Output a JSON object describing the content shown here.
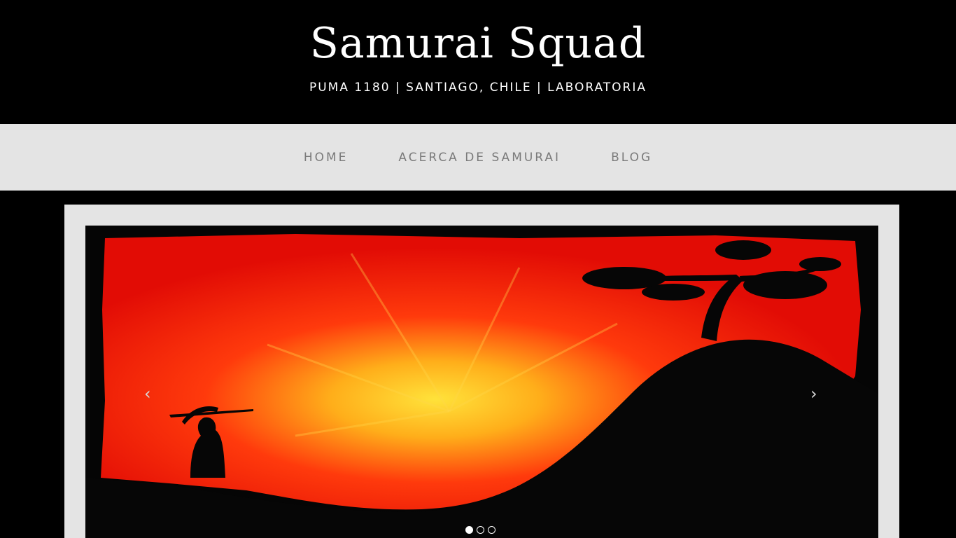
{
  "header": {
    "title": "Samurai Squad",
    "tagline": "PUMA 1180 | SANTIAGO, CHILE | LABORATORIA"
  },
  "nav": {
    "items": [
      {
        "label": "HOME"
      },
      {
        "label": "ACERCA DE SAMURAI"
      },
      {
        "label": "BLOG"
      }
    ]
  },
  "slider": {
    "prev_icon": "‹",
    "next_icon": "›",
    "slide_image": "samurai-silhouette-red-sunset",
    "slide_count": 3,
    "active_slide": 1
  },
  "colors": {
    "header_bg": "#000000",
    "nav_bg": "#e4e4e4",
    "nav_text": "#7a7a7a",
    "title_text": "#ffffff"
  }
}
